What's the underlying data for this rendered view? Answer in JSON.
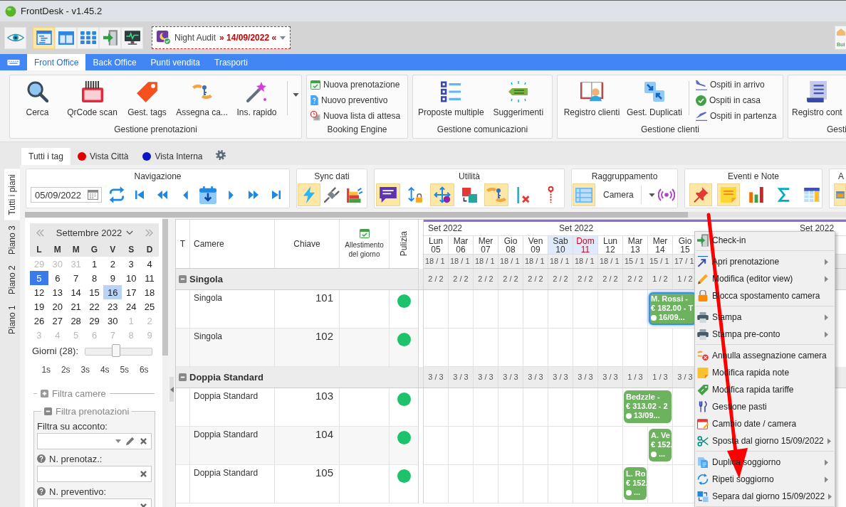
{
  "window": {
    "title": "FrontDesk - v1.45.2"
  },
  "toolbar": {
    "view_buttons": [
      {
        "selected": true
      },
      {
        "selected": false
      },
      {
        "selected": false
      },
      {
        "selected": false
      },
      {
        "selected": false
      }
    ],
    "night_audit": {
      "label": "Night Audit",
      "date": "» 14/09/2022 «"
    },
    "corner_button": {
      "label": "Bui"
    }
  },
  "menu_tabs": [
    {
      "label": "Front Office",
      "selected": true
    },
    {
      "label": "Back Office",
      "selected": false
    },
    {
      "label": "Punti vendita",
      "selected": false
    },
    {
      "label": "Trasporti",
      "selected": false
    }
  ],
  "ribbon": [
    {
      "title": "Gestione prenotazioni",
      "large": [
        "Cerca",
        "QrCode scan",
        "Gest. tags",
        "Assegna ca...",
        "Ins. rapido"
      ],
      "more": true
    },
    {
      "title": "Booking Engine",
      "small": [
        "Nuova prenotazione",
        "Nuovo preventivo",
        "Nuova lista di attesa"
      ],
      "more": false
    },
    {
      "title": "Gestione comunicazioni",
      "large": [
        "Proposte multiple",
        "Suggerimenti"
      ],
      "more": false
    },
    {
      "title": "Gestione clienti",
      "large": [
        "Registro clienti",
        "Gest. Duplicati"
      ],
      "small": [
        "Ospiti in arrivo",
        "Ospiti in casa",
        "Ospiti in partenza"
      ],
      "more": false
    },
    {
      "title": "Gesti",
      "large": [
        "Registro cont"
      ],
      "more": false
    }
  ],
  "tag_tabs": [
    {
      "label": "Tutti i tag",
      "selected": true
    },
    {
      "label": "Vista Città",
      "selected": false,
      "color": "#e00000"
    },
    {
      "label": "Vista Interna",
      "selected": false,
      "color": "#0a14c8"
    }
  ],
  "floor_tabs": [
    {
      "label": "Tutti i piani",
      "selected": true
    },
    {
      "label": "Piano 3",
      "selected": false
    },
    {
      "label": "Piano 2",
      "selected": false
    },
    {
      "label": "Piano 1",
      "selected": false
    }
  ],
  "tool_groups": [
    {
      "title": "Navigazione",
      "items": [
        {
          "kind": "date",
          "value": "05/09/2022"
        },
        {
          "kind": "button",
          "selected": false
        },
        {
          "kind": "button",
          "selected": false
        },
        {
          "kind": "button",
          "selected": false
        },
        {
          "kind": "button",
          "selected": false
        },
        {
          "kind": "button",
          "selected": false
        },
        {
          "kind": "button",
          "selected": false
        },
        {
          "kind": "button",
          "selected": false
        },
        {
          "kind": "button",
          "selected": false
        }
      ]
    },
    {
      "title": "Sync dati",
      "items": [
        {
          "kind": "button",
          "selected": true
        },
        {
          "kind": "button",
          "selected": false
        },
        {
          "kind": "button",
          "selected": false
        }
      ]
    },
    {
      "title": "Utilità",
      "items": [
        {
          "kind": "button",
          "selected": true
        },
        {
          "kind": "button",
          "selected": false
        },
        {
          "kind": "button",
          "selected": true
        },
        {
          "kind": "button",
          "selected": false
        },
        {
          "kind": "button",
          "selected": true
        },
        {
          "kind": "button",
          "selected": false
        },
        {
          "kind": "button",
          "selected": false
        }
      ]
    },
    {
      "title": "Raggruppamento",
      "items": [
        {
          "kind": "button",
          "selected": true
        },
        {
          "kind": "select",
          "value": "Camera"
        },
        {
          "kind": "button",
          "selected": false
        }
      ]
    },
    {
      "title": "Eventi e Note",
      "items": [
        {
          "kind": "button",
          "selected": true
        },
        {
          "kind": "button",
          "selected": true
        },
        {
          "kind": "button",
          "selected": false
        },
        {
          "kind": "button",
          "selected": false
        },
        {
          "kind": "button",
          "selected": false
        }
      ]
    },
    {
      "title": "A",
      "items": [
        {
          "kind": "button",
          "selected": true
        }
      ]
    }
  ],
  "mini_calendar": {
    "month": "Settembre 2022",
    "weekdays": [
      "L",
      "M",
      "M",
      "G",
      "V",
      "S",
      "D"
    ],
    "weeks": [
      [
        {
          "day": "29",
          "muted": true,
          "selected": false,
          "today": false
        },
        {
          "day": "30",
          "muted": true,
          "selected": false,
          "today": false
        },
        {
          "day": "31",
          "muted": true,
          "selected": false,
          "today": false
        },
        {
          "day": "1",
          "muted": false,
          "selected": false,
          "today": false
        },
        {
          "day": "2",
          "muted": false,
          "selected": false,
          "today": false
        },
        {
          "day": "3",
          "muted": false,
          "selected": false,
          "today": false
        },
        {
          "day": "4",
          "muted": false,
          "selected": false,
          "today": false
        }
      ],
      [
        {
          "day": "5",
          "muted": false,
          "selected": true,
          "today": false
        },
        {
          "day": "6",
          "muted": false,
          "selected": false,
          "today": false
        },
        {
          "day": "7",
          "muted": false,
          "selected": false,
          "today": false
        },
        {
          "day": "8",
          "muted": false,
          "selected": false,
          "today": false
        },
        {
          "day": "9",
          "muted": false,
          "selected": false,
          "today": false
        },
        {
          "day": "10",
          "muted": false,
          "selected": false,
          "today": false
        },
        {
          "day": "11",
          "muted": false,
          "selected": false,
          "today": false
        }
      ],
      [
        {
          "day": "12",
          "muted": false,
          "selected": false,
          "today": false
        },
        {
          "day": "13",
          "muted": false,
          "selected": false,
          "today": false
        },
        {
          "day": "14",
          "muted": false,
          "selected": false,
          "today": false
        },
        {
          "day": "15",
          "muted": false,
          "selected": false,
          "today": false
        },
        {
          "day": "16",
          "muted": false,
          "selected": false,
          "today": true
        },
        {
          "day": "17",
          "muted": false,
          "selected": false,
          "today": false
        },
        {
          "day": "18",
          "muted": false,
          "selected": false,
          "today": false
        }
      ],
      [
        {
          "day": "19",
          "muted": false,
          "selected": false,
          "today": false
        },
        {
          "day": "20",
          "muted": false,
          "selected": false,
          "today": false
        },
        {
          "day": "21",
          "muted": false,
          "selected": false,
          "today": false
        },
        {
          "day": "22",
          "muted": false,
          "selected": false,
          "today": false
        },
        {
          "day": "23",
          "muted": false,
          "selected": false,
          "today": false
        },
        {
          "day": "24",
          "muted": false,
          "selected": false,
          "today": false
        },
        {
          "day": "25",
          "muted": false,
          "selected": false,
          "today": false
        }
      ],
      [
        {
          "day": "26",
          "muted": false,
          "selected": false,
          "today": false
        },
        {
          "day": "27",
          "muted": false,
          "selected": false,
          "today": false
        },
        {
          "day": "28",
          "muted": false,
          "selected": false,
          "today": false
        },
        {
          "day": "29",
          "muted": false,
          "selected": false,
          "today": false
        },
        {
          "day": "30",
          "muted": false,
          "selected": false,
          "today": false
        },
        {
          "day": "1",
          "muted": true,
          "selected": false,
          "today": false
        },
        {
          "day": "2",
          "muted": true,
          "selected": false,
          "today": false
        }
      ],
      [
        {
          "day": "3",
          "muted": true,
          "selected": false,
          "today": false
        },
        {
          "day": "4",
          "muted": true,
          "selected": false,
          "today": false
        },
        {
          "day": "5",
          "muted": true,
          "selected": false,
          "today": false
        },
        {
          "day": "6",
          "muted": true,
          "selected": false,
          "today": false
        },
        {
          "day": "7",
          "muted": true,
          "selected": false,
          "today": false
        },
        {
          "day": "8",
          "muted": true,
          "selected": false,
          "today": false
        },
        {
          "day": "9",
          "muted": true,
          "selected": false,
          "today": false
        }
      ]
    ]
  },
  "days_slider": {
    "label": "Giorni (28):",
    "level": 0.46,
    "ticks": [
      "1s",
      "2s",
      "3s",
      "4s",
      "5s",
      "6s"
    ]
  },
  "filters": [
    {
      "title": "Filtra camere",
      "expanded": false
    },
    {
      "title": "Filtra prenotazioni",
      "expanded": true,
      "fields": [
        {
          "kind": "combo",
          "label": "Filtra su acconto:"
        },
        {
          "kind": "text",
          "label": "N. prenotaz.:"
        },
        {
          "kind": "text",
          "label": "N. preventivo:"
        }
      ]
    }
  ],
  "grid": {
    "columns": [
      "T",
      "Camere",
      "Chiave",
      "Allestimento del giorno",
      "Pulizia"
    ],
    "months": [
      "Set 2022",
      "Set 2022",
      "Set 2022"
    ],
    "days": [
      {
        "weekday": "Lun",
        "date": "05",
        "kind": "weekday",
        "occupancy": "18 / 1"
      },
      {
        "weekday": "Mar",
        "date": "06",
        "kind": "weekday",
        "occupancy": "18 / 1"
      },
      {
        "weekday": "Mer",
        "date": "07",
        "kind": "weekday",
        "occupancy": "18 / 1"
      },
      {
        "weekday": "Gio",
        "date": "08",
        "kind": "weekday",
        "occupancy": "18 / 1"
      },
      {
        "weekday": "Ven",
        "date": "09",
        "kind": "weekday",
        "occupancy": "18 / 1"
      },
      {
        "weekday": "Sab",
        "date": "10",
        "kind": "saturday",
        "occupancy": "18 / 1"
      },
      {
        "weekday": "Dom",
        "date": "11",
        "kind": "sunday",
        "occupancy": "18 / 1"
      },
      {
        "weekday": "Lun",
        "date": "12",
        "kind": "weekday",
        "occupancy": "18 / 1"
      },
      {
        "weekday": "Mar",
        "date": "13",
        "kind": "weekday",
        "occupancy": "15 / 1"
      },
      {
        "weekday": "Mer",
        "date": "14",
        "kind": "weekday",
        "occupancy": "15 / 1"
      },
      {
        "weekday": "Gio",
        "date": "15",
        "kind": "weekday",
        "occupancy": "17 / 1"
      }
    ],
    "groups": [
      {
        "name": "Singola",
        "expanded": true,
        "counts": [
          "2 / 2",
          "2 / 2",
          "2 / 2",
          "2 / 2",
          "2 / 2",
          "2 / 2",
          "2 / 2",
          "2 / 2",
          "2 / 2",
          "1 / 2",
          "1 / 2"
        ],
        "rooms": [
          {
            "type": "Singola",
            "key": "101",
            "color": "#1ec26b",
            "cells": [
              {
                "kind": "free"
              },
              {
                "kind": "free"
              },
              {
                "kind": "free"
              },
              {
                "kind": "free"
              },
              {
                "kind": "free"
              },
              {
                "kind": "free"
              },
              {
                "kind": "free"
              },
              {
                "kind": "free"
              },
              {
                "kind": "free"
              },
              {
                "kind": "booking",
                "guest": "M. Rossi -",
                "price": "€ 182.00 - T",
                "arrival": "16/09...",
                "selected": true
              },
              {
                "kind": "continued"
              }
            ]
          },
          {
            "type": "Singola",
            "key": "102",
            "color": "#1ec26b",
            "cells": [
              {
                "kind": "free"
              },
              {
                "kind": "free"
              },
              {
                "kind": "free"
              },
              {
                "kind": "free"
              },
              {
                "kind": "free"
              },
              {
                "kind": "free"
              },
              {
                "kind": "free"
              },
              {
                "kind": "free"
              },
              {
                "kind": "free"
              },
              {
                "kind": "free"
              },
              {
                "kind": "free"
              }
            ]
          }
        ]
      },
      {
        "name": "Doppia Standard",
        "expanded": true,
        "counts": [
          "3 / 3",
          "3 / 3",
          "3 / 3",
          "3 / 3",
          "3 / 3",
          "3 / 3",
          "3 / 3",
          "3 / 3",
          "1 / 3",
          "1 / 3",
          "3 / 3"
        ],
        "rooms": [
          {
            "type": "Doppia Standard",
            "key": "103",
            "color": "#1ec26b",
            "cells": [
              {
                "kind": "free"
              },
              {
                "kind": "free"
              },
              {
                "kind": "free"
              },
              {
                "kind": "free"
              },
              {
                "kind": "free"
              },
              {
                "kind": "free"
              },
              {
                "kind": "free"
              },
              {
                "kind": "free"
              },
              {
                "kind": "booking",
                "guest": "Bedzzle -",
                "price": "€ 313.02 - 2",
                "arrival": "13/09...",
                "selected": false
              },
              {
                "kind": "continued"
              },
              {
                "kind": "free"
              }
            ]
          },
          {
            "type": "Doppia Standard",
            "key": "104",
            "color": "#1ec26b",
            "cells": [
              {
                "kind": "free"
              },
              {
                "kind": "free"
              },
              {
                "kind": "free"
              },
              {
                "kind": "free"
              },
              {
                "kind": "free"
              },
              {
                "kind": "free"
              },
              {
                "kind": "free"
              },
              {
                "kind": "free"
              },
              {
                "kind": "free"
              },
              {
                "kind": "booking",
                "guest": "A. Ve",
                "price": "€ 152.",
                "arrival": "...",
                "selected": false
              },
              {
                "kind": "free"
              }
            ]
          },
          {
            "type": "Doppia Standard",
            "key": "105",
            "color": "#1ec26b",
            "cells": [
              {
                "kind": "free"
              },
              {
                "kind": "free"
              },
              {
                "kind": "free"
              },
              {
                "kind": "free"
              },
              {
                "kind": "free"
              },
              {
                "kind": "free"
              },
              {
                "kind": "free"
              },
              {
                "kind": "free"
              },
              {
                "kind": "booking",
                "guest": "L. Ro",
                "price": "€ 152.",
                "arrival": "...",
                "selected": false
              },
              {
                "kind": "free"
              },
              {
                "kind": "free"
              }
            ]
          }
        ]
      }
    ]
  },
  "context_menu": {
    "sections": [
      [
        {
          "label": "Check-in",
          "submenu": false
        }
      ],
      [
        {
          "label": "Apri prenotazione",
          "submenu": true
        },
        {
          "label": "Modifica (editor view)",
          "submenu": true
        },
        {
          "label": "Blocca spostamento camera",
          "submenu": false
        }
      ],
      [
        {
          "label": "Stampa",
          "submenu": true
        },
        {
          "label": "Stampa pre-conto",
          "submenu": true
        }
      ],
      [
        {
          "label": "Annulla assegnazione camera",
          "submenu": false
        },
        {
          "label": "Modifica rapida note",
          "submenu": false
        },
        {
          "label": "Modifica rapida tariffe",
          "submenu": false
        },
        {
          "label": "Gestione pasti",
          "submenu": false
        },
        {
          "label": "Cambio date / camera",
          "submenu": false
        },
        {
          "label": "Sposta dal giorno 15/09/2022",
          "submenu": true
        }
      ],
      [
        {
          "label": "Duplica soggiorno",
          "submenu": true
        },
        {
          "label": "Ripeti soggiorno",
          "submenu": true
        },
        {
          "label": "Separa dal giorno 15/09/2022",
          "submenu": true
        }
      ]
    ]
  }
}
